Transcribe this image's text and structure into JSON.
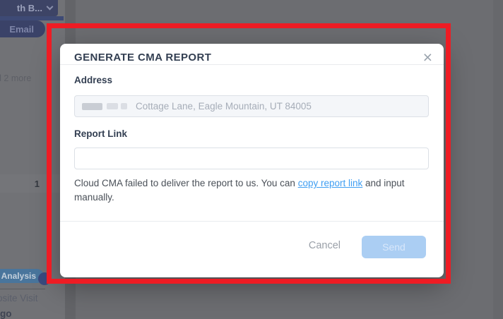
{
  "background": {
    "top_button_label": "th B...",
    "email_badge": "Email",
    "more_text": "d 2 more",
    "count_badge": "1",
    "analysis_badge": "Analysis",
    "visit_text": "osite Visit",
    "ago_text": "go"
  },
  "modal": {
    "title": "GENERATE CMA REPORT",
    "close_icon": "×",
    "address": {
      "label": "Address",
      "value": "Cottage Lane, Eagle Mountain, UT 84005"
    },
    "report_link": {
      "label": "Report Link",
      "value": ""
    },
    "helper": {
      "text_before": "Cloud CMA failed to deliver the report to us. You can ",
      "link": "copy report link",
      "text_after": " and input manually."
    },
    "footer": {
      "cancel_label": "Cancel",
      "send_label": "Send"
    }
  },
  "colors": {
    "highlight_red": "#ee1c24",
    "link_blue": "#3f9ef2",
    "send_button_bg": "#abcef3",
    "title_navy": "#333f52",
    "backdrop_dim": "#6c6d71"
  }
}
